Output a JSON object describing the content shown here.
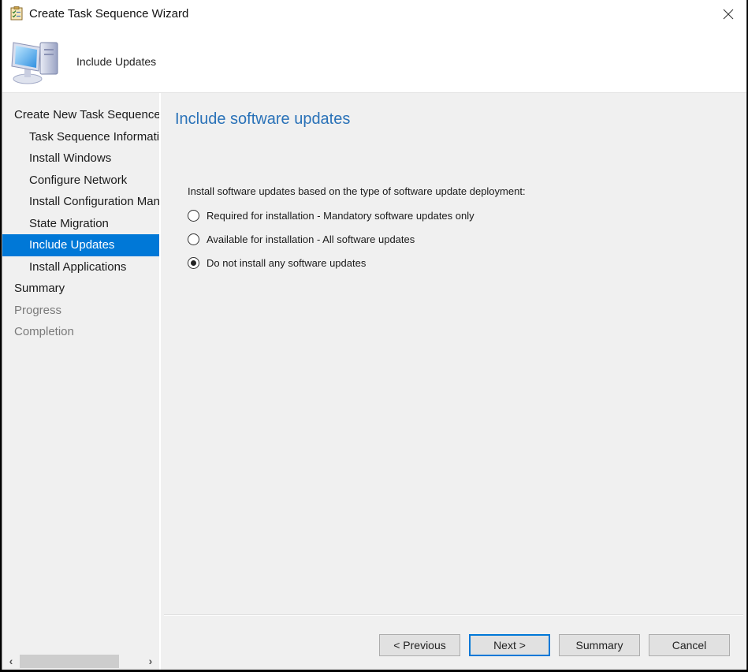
{
  "window": {
    "title": "Create Task Sequence Wizard",
    "close_label": "Close"
  },
  "header": {
    "title": "Include Updates"
  },
  "sidebar": {
    "items": [
      {
        "label": "Create New Task Sequence",
        "level": 0,
        "state": "normal"
      },
      {
        "label": "Task Sequence Information",
        "level": 1,
        "state": "normal"
      },
      {
        "label": "Install Windows",
        "level": 1,
        "state": "normal"
      },
      {
        "label": "Configure Network",
        "level": 1,
        "state": "normal"
      },
      {
        "label": "Install Configuration Manager",
        "level": 1,
        "state": "normal"
      },
      {
        "label": "State Migration",
        "level": 1,
        "state": "normal"
      },
      {
        "label": "Include Updates",
        "level": 1,
        "state": "selected"
      },
      {
        "label": "Install Applications",
        "level": 1,
        "state": "normal"
      },
      {
        "label": "Summary",
        "level": 0,
        "state": "normal"
      },
      {
        "label": "Progress",
        "level": 0,
        "state": "disabled"
      },
      {
        "label": "Completion",
        "level": 0,
        "state": "disabled"
      }
    ],
    "scroll": {
      "left_arrow": "‹",
      "right_arrow": "›"
    }
  },
  "content": {
    "title": "Include software updates",
    "prompt": "Install software updates based on the type of software update deployment:",
    "options": [
      {
        "label": "Required for installation - Mandatory software updates only",
        "checked": false
      },
      {
        "label": "Available for installation - All software updates",
        "checked": false
      },
      {
        "label": "Do not install any software updates",
        "checked": true
      }
    ]
  },
  "buttons": {
    "previous": "< Previous",
    "next": "Next >",
    "summary": "Summary",
    "cancel": "Cancel"
  },
  "colors": {
    "accent": "#0078d7",
    "title_blue": "#2a72b8",
    "disabled_text": "#7a7a7a"
  }
}
